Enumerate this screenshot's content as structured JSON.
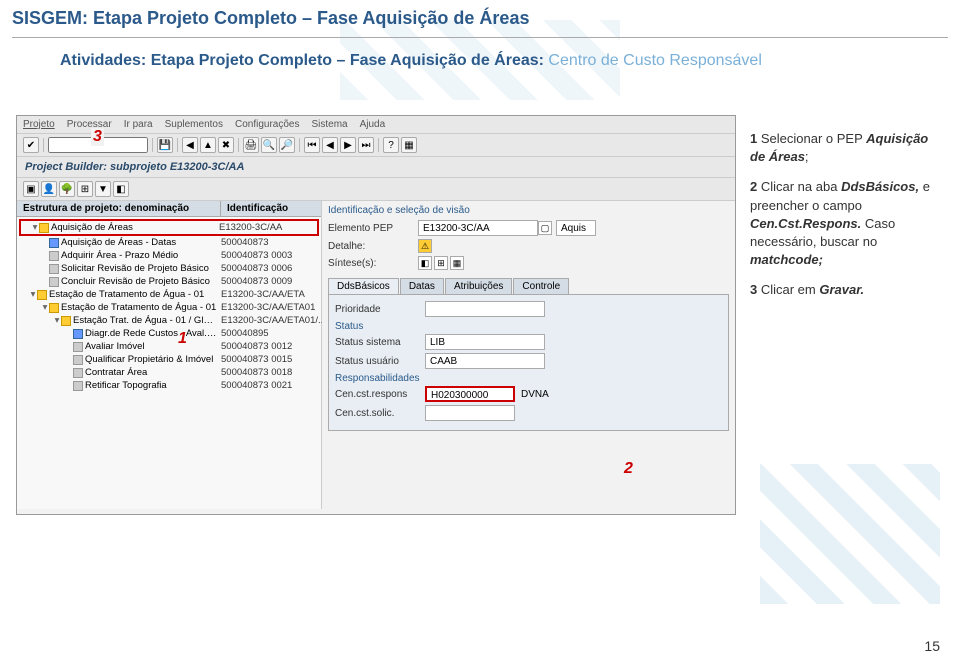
{
  "page": {
    "main_title": "SISGEM: Etapa Projeto Completo – Fase Aquisição de Áreas",
    "section_bold": "Atividades: Etapa Projeto Completo – Fase Aquisição de Áreas: ",
    "section_light": "Centro de Custo Responsável",
    "page_number": "15"
  },
  "sap": {
    "menu": [
      "Projeto",
      "Processar",
      "Ir para",
      "Suplementos",
      "Configurações",
      "Sistema",
      "Ajuda"
    ],
    "window_title": "Project Builder: subprojeto E13200-3C/AA",
    "tree_header": {
      "col1": "Estrutura de projeto: denominação",
      "col2": "Identificação"
    },
    "tree": [
      {
        "lvl": 1,
        "icon": "yellow",
        "tri": "▾",
        "label": "Aquisição de Áreas",
        "id": "E13200-3C/AA",
        "hl": true
      },
      {
        "lvl": 2,
        "icon": "blue",
        "tri": "",
        "label": "Aquisição de Áreas - Datas",
        "id": "500040873"
      },
      {
        "lvl": 2,
        "icon": "gray",
        "tri": "",
        "label": "Adquirir Área - Prazo Médio",
        "id": "500040873 0003"
      },
      {
        "lvl": 2,
        "icon": "gray",
        "tri": "",
        "label": "Solicitar Revisão de Projeto Básico",
        "id": "500040873 0006"
      },
      {
        "lvl": 2,
        "icon": "gray",
        "tri": "",
        "label": "Concluir Revisão de Projeto Básico",
        "id": "500040873 0009"
      },
      {
        "lvl": 1,
        "icon": "yellow",
        "tri": "▾",
        "label": "Estação de Tratamento de Água - 01",
        "id": "E13200-3C/AA/ETA"
      },
      {
        "lvl": 2,
        "icon": "yellow",
        "tri": "▾",
        "label": "Estação de Tratamento de Água - 01",
        "id": "E13200-3C/AA/ETA01"
      },
      {
        "lvl": 3,
        "icon": "yellow",
        "tri": "▾",
        "label": "Estação Trat. de Água - 01 / Gleba 001",
        "id": "E13200-3C/AA/ETA01/..."
      },
      {
        "lvl": 4,
        "icon": "blue",
        "tri": "",
        "label": "Diagr.de Rede Custos - Aval. de Áreas",
        "id": "500040895"
      },
      {
        "lvl": 4,
        "icon": "gray",
        "tri": "",
        "label": "Avaliar Imóvel",
        "id": "500040873 0012"
      },
      {
        "lvl": 4,
        "icon": "gray",
        "tri": "",
        "label": "Qualificar Propietário & Imóvel",
        "id": "500040873 0015"
      },
      {
        "lvl": 4,
        "icon": "gray",
        "tri": "",
        "label": "Contratar Área",
        "id": "500040873 0018"
      },
      {
        "lvl": 4,
        "icon": "gray",
        "tri": "",
        "label": "Retificar Topografia",
        "id": "500040873 0021"
      }
    ],
    "right": {
      "top_label": "Identificação e seleção de visão",
      "fields": {
        "elemento_label": "Elemento PEP",
        "elemento_val": "E13200-3C/AA",
        "elemento_extra": "Aquis",
        "detalhe_label": "Detalhe:",
        "sintese_label": "Síntese(s):"
      },
      "tabs": [
        "DdsBásicos",
        "Datas",
        "Atribuições",
        "Controle"
      ],
      "prioridade_label": "Prioridade",
      "status_label": "Status",
      "status_sistema_label": "Status sistema",
      "status_sistema_val": "LIB",
      "status_usuario_label": "Status usuário",
      "status_usuario_val": "CAAB",
      "resp_label": "Responsabilidades",
      "cen_respons_label": "Cen.cst.respons",
      "cen_respons_val": "H020300000",
      "cen_respons_extra": "DVNA",
      "cen_solic_label": "Cen.cst.solic."
    }
  },
  "instructions": {
    "step1_num": "1",
    "step1_a": " Selecionar o PEP ",
    "step1_b": "Aquisição de Áreas",
    "step1_c": ";",
    "step2_num": "2",
    "step2_a": " Clicar na aba ",
    "step2_b": "DdsBásicos,",
    "step2_c": " e preencher o campo ",
    "step2_d": "Cen.Cst.Respons.",
    "step2_e": " Caso necessário, buscar no ",
    "step2_f": "matchcode;",
    "step3_num": "3",
    "step3_a": " Clicar em ",
    "step3_b": "Gravar."
  },
  "markers": {
    "m1": "1",
    "m2": "2",
    "m3": "3"
  }
}
